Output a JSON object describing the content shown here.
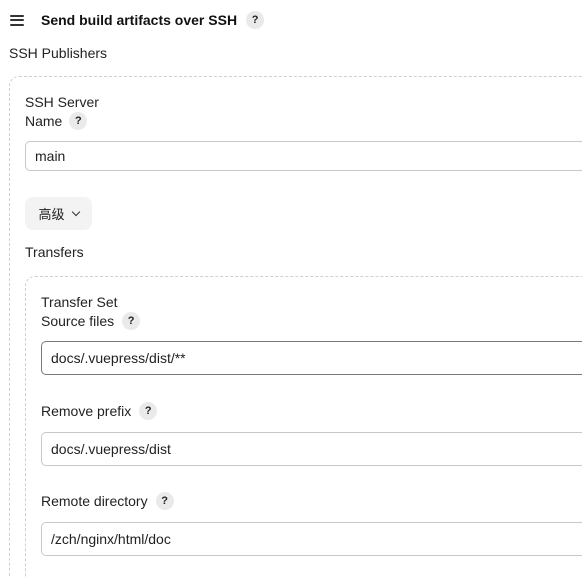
{
  "section": {
    "title": "Send build artifacts over SSH",
    "help": "?"
  },
  "ssh_publishers": {
    "label": "SSH Publishers",
    "server": {
      "heading": "SSH Server",
      "name_label": "Name",
      "name_help": "?",
      "name_value": "main",
      "advanced_label": "高级",
      "transfers_label": "Transfers",
      "transfer_set": {
        "heading": "Transfer Set",
        "source_files_label": "Source files",
        "source_files_help": "?",
        "source_files_value": "docs/.vuepress/dist/**",
        "remove_prefix_label": "Remove prefix",
        "remove_prefix_help": "?",
        "remove_prefix_value": "docs/.vuepress/dist",
        "remote_directory_label": "Remote directory",
        "remote_directory_help": "?",
        "remote_directory_value": "/zch/nginx/html/doc"
      }
    }
  },
  "icons": {
    "drag_handle": "drag-handle-icon",
    "help": "help-icon",
    "chevron": "chevron-down-icon"
  }
}
